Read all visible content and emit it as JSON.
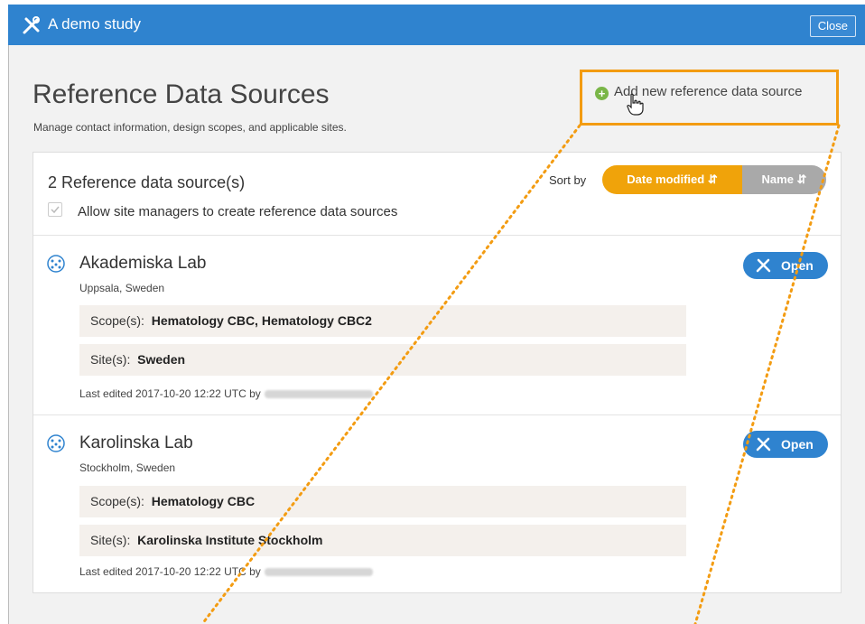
{
  "app": {
    "title": "A demo study",
    "close_label": "Close"
  },
  "header": {
    "title": "Reference Data Sources",
    "subtitle": "Manage contact information, design scopes, and applicable sites.",
    "add_label": "Add new reference data source"
  },
  "list": {
    "count_label": "2 Reference data source(s)",
    "allow_label": "Allow site managers to create reference data sources",
    "allow_checked": true,
    "sort_label": "Sort by",
    "sort_options": [
      {
        "label": "Date modified ⇵",
        "active": true
      },
      {
        "label": "Name ⇵",
        "active": false
      }
    ]
  },
  "items": [
    {
      "name": "Akademiska Lab",
      "location": "Uppsala, Sweden",
      "open_label": "Open",
      "scope_label": "Scope(s):",
      "scope_value": "Hematology CBC, Hematology CBC2",
      "site_label": "Site(s):",
      "site_value": "Sweden",
      "edited": "Last edited 2017-10-20 12:22 UTC by"
    },
    {
      "name": "Karolinska Lab",
      "location": "Stockholm, Sweden",
      "open_label": "Open",
      "scope_label": "Scope(s):",
      "scope_value": "Hematology CBC",
      "site_label": "Site(s):",
      "site_value": "Karolinska Institute Stockholm",
      "edited": "Last edited 2017-10-20 12:22 UTC by"
    }
  ],
  "colors": {
    "accent": "#2f83cf",
    "sort_active": "#f0a30a",
    "highlight": "#f39c12",
    "add_icon": "#7ab648"
  },
  "icons": {
    "logo": "tools-icon",
    "add": "plus-circle-icon",
    "cursor": "hand-pointer-icon",
    "item": "globe-network-icon",
    "open": "tools-icon"
  }
}
